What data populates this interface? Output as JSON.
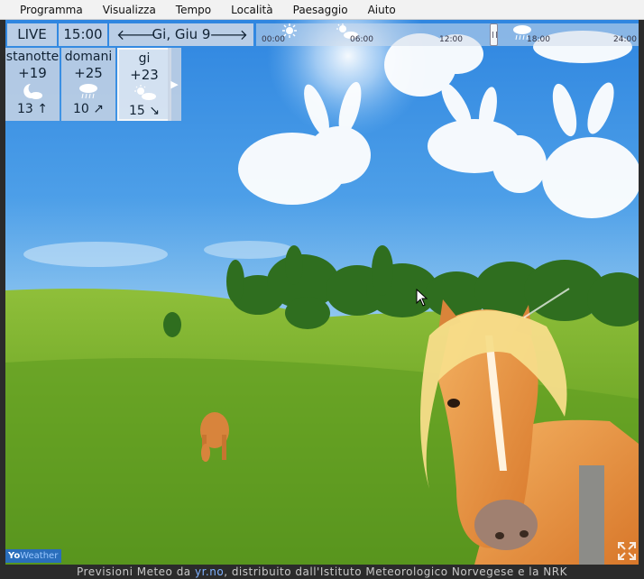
{
  "menu": [
    "Programma",
    "Visualizza",
    "Tempo",
    "Località",
    "Paesaggio",
    "Aiuto"
  ],
  "toolbar": {
    "live_label": "LIVE",
    "time_value": "15:00",
    "date_label": "Gi, Giu 9",
    "prev_arrow": "🡐",
    "next_arrow": "🡒"
  },
  "timeline": {
    "ticks": [
      "00:00",
      "06:00",
      "12:00",
      "18:00",
      "24:00"
    ],
    "icons": [
      "sun-icon",
      "sun-cloud-icon",
      "cloud-rain-icon"
    ],
    "current_fraction": 0.625
  },
  "cards": [
    {
      "name": "stanotte",
      "temp": "+19",
      "icon": "moon-cloud-icon",
      "wind": "13 ↑"
    },
    {
      "name": "domani",
      "temp": "+25",
      "icon": "cloud-rain-icon",
      "wind": "10 ↗"
    },
    {
      "name": "gi",
      "temp": "+23",
      "icon": "sun-cloud-icon",
      "wind": "15 ↘"
    }
  ],
  "cards_next_arrow": "▶",
  "footer": {
    "prefix": "Previsioni Meteo da ",
    "link": "yr.no",
    "suffix": ", distribuito dall'Istituto Meteorologico Norvegese e la NRK"
  },
  "logo": {
    "yo": "Yo",
    "rest": "Weather"
  }
}
